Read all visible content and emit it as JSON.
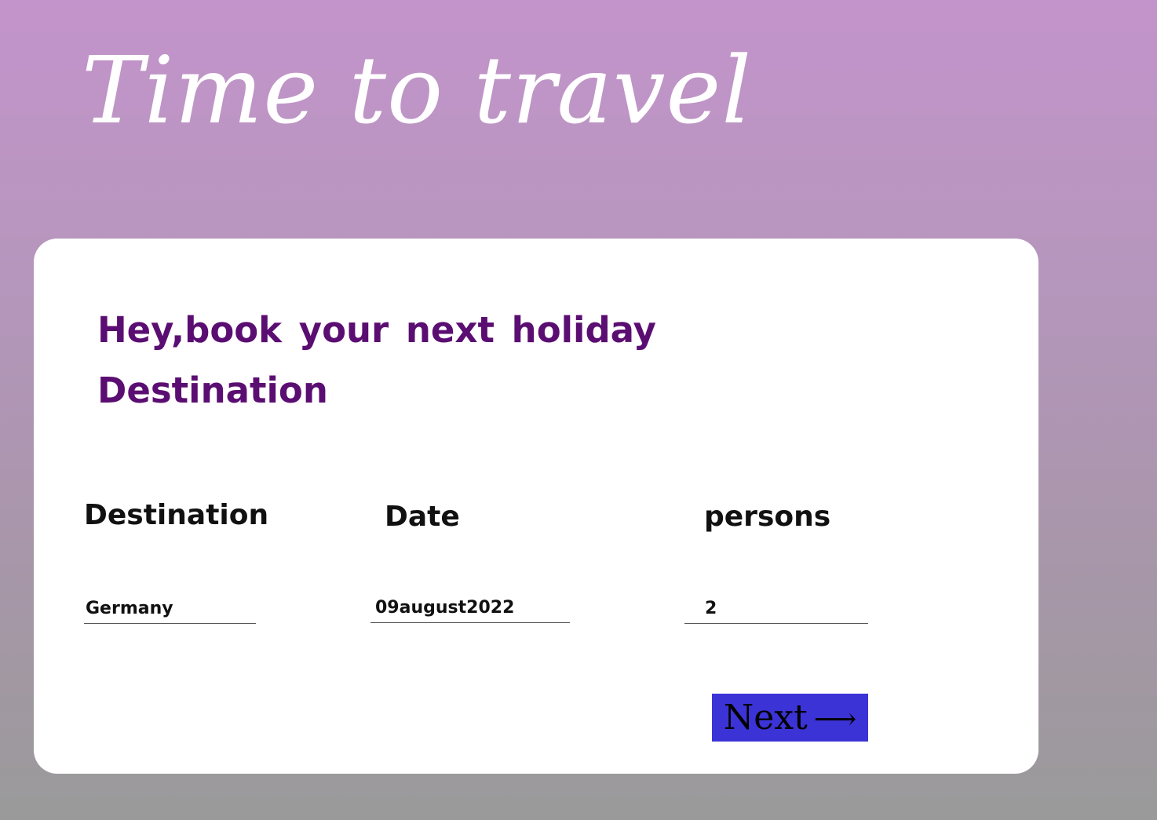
{
  "hero": {
    "title": "Time to travel"
  },
  "card": {
    "headline": "Hey,book your next holiday Destination",
    "fields": {
      "destination": {
        "label": "Destination",
        "value": "Germany"
      },
      "date": {
        "label": "Date",
        "value": "09august2022"
      },
      "persons": {
        "label": "persons",
        "value": "2"
      }
    },
    "next_button": {
      "label": "Next",
      "icon": "arrow-right-icon",
      "arrow": "⟶",
      "color": "#3b33d6"
    }
  },
  "colors": {
    "background_top": "#c394cb",
    "background_bottom": "#9a9a9a",
    "headline": "#5b0e72",
    "card": "#ffffff"
  }
}
